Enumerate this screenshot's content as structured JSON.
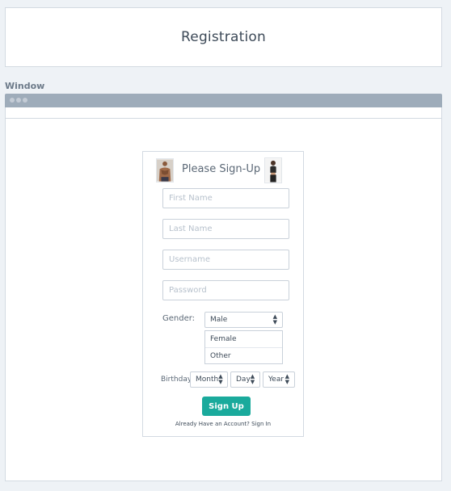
{
  "header": {
    "title": "Registration"
  },
  "window": {
    "label": "Window"
  },
  "form": {
    "heading": "Please Sign-Up",
    "fields": {
      "first_name_placeholder": "First Name",
      "last_name_placeholder": "Last Name",
      "username_placeholder": "Username",
      "password_placeholder": "Password"
    },
    "gender": {
      "label": "Gender:",
      "selected": "Male",
      "options": [
        "Female",
        "Other"
      ]
    },
    "birthday": {
      "label": "Birthday",
      "month": "Month",
      "day": "Day",
      "year": "Year"
    },
    "signup_label": "Sign Up",
    "signin_text": "Already Have an Account? Sign In"
  },
  "colors": {
    "accent": "#1aaa9c",
    "window_bar": "#9eacba",
    "background": "#eef2f6"
  },
  "icons": {
    "avatar_left": "male-avatar-icon",
    "avatar_right": "female-avatar-icon",
    "select_arrows": "updown-arrows-icon",
    "window_controls": "window-dots-icon"
  }
}
